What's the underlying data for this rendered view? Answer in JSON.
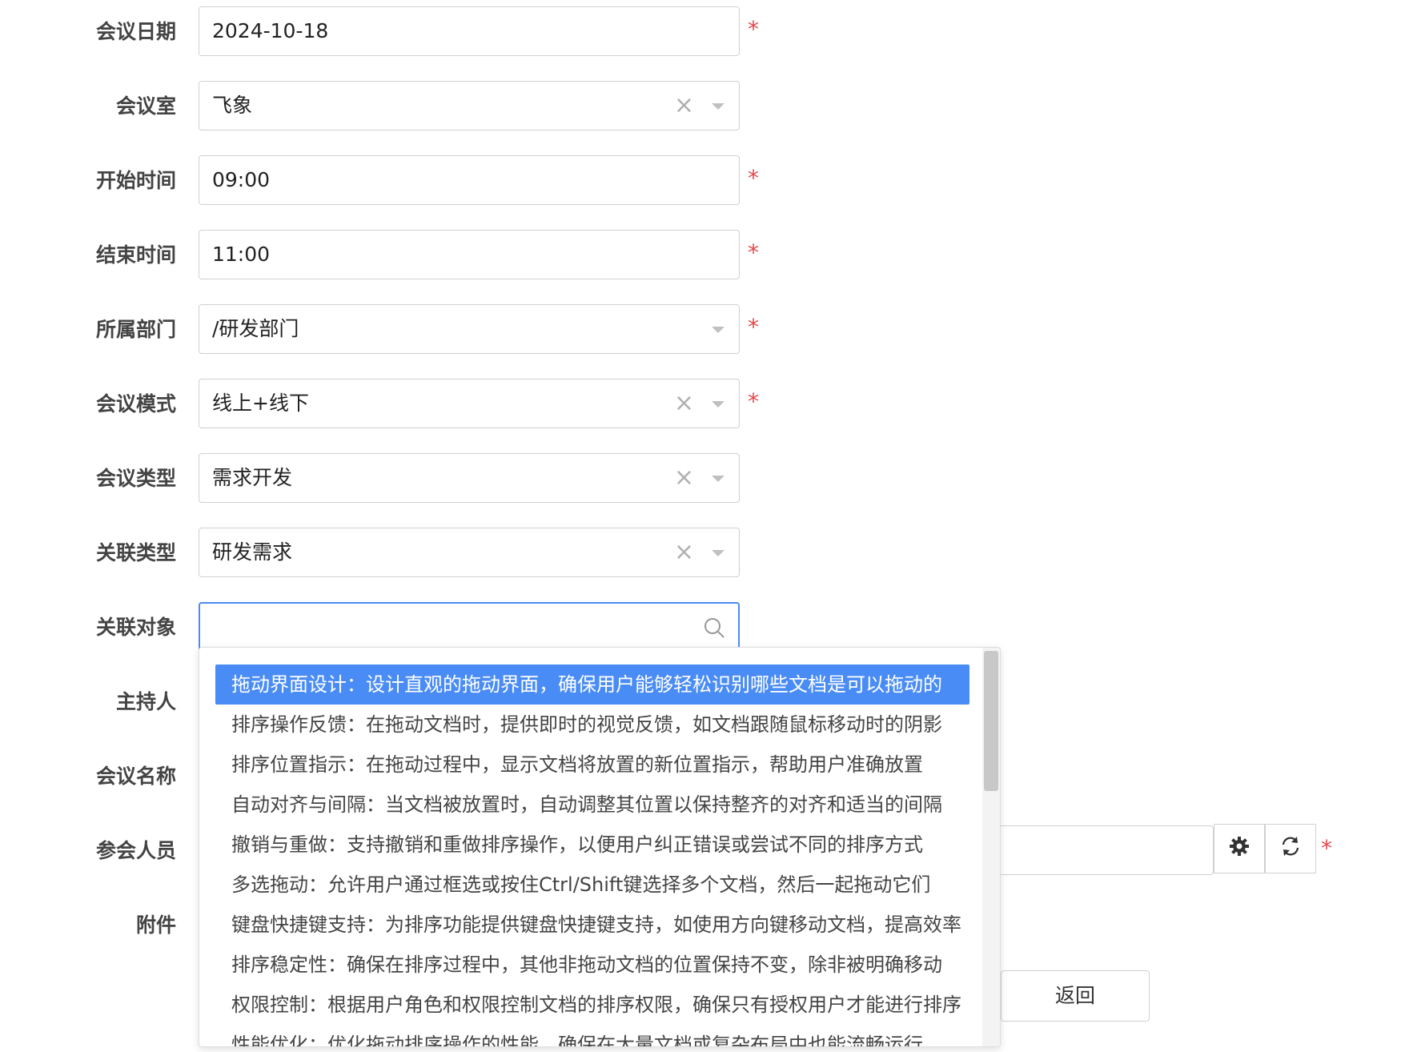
{
  "form": {
    "meeting_date": {
      "label": "会议日期",
      "value": "2024-10-18"
    },
    "meeting_room": {
      "label": "会议室",
      "value": "飞象"
    },
    "start_time": {
      "label": "开始时间",
      "value": "09:00"
    },
    "end_time": {
      "label": "结束时间",
      "value": "11:00"
    },
    "department": {
      "label": "所属部门",
      "value": "/研发部门"
    },
    "meeting_mode": {
      "label": "会议模式",
      "value": "线上+线下"
    },
    "meeting_type": {
      "label": "会议类型",
      "value": "需求开发"
    },
    "related_type": {
      "label": "关联类型",
      "value": "研发需求"
    },
    "related_object": {
      "label": "关联对象",
      "value": ""
    },
    "host": {
      "label": "主持人"
    },
    "meeting_name": {
      "label": "会议名称"
    },
    "participants": {
      "label": "参会人员"
    },
    "attachment": {
      "label": "附件"
    }
  },
  "required_mark": "*",
  "clear_glyph": "×",
  "dropdown": {
    "items": [
      "拖动界面设计：设计直观的拖动界面，确保用户能够轻松识别哪些文档是可以拖动的",
      "排序操作反馈：在拖动文档时，提供即时的视觉反馈，如文档跟随鼠标移动时的阴影",
      "排序位置指示：在拖动过程中，显示文档将放置的新位置指示，帮助用户准确放置",
      "自动对齐与间隔：当文档被放置时，自动调整其位置以保持整齐的对齐和适当的间隔",
      "撤销与重做：支持撤销和重做排序操作，以便用户纠正错误或尝试不同的排序方式",
      "多选拖动：允许用户通过框选或按住Ctrl/Shift键选择多个文档，然后一起拖动它们",
      "键盘快捷键支持：为排序功能提供键盘快捷键支持，如使用方向键移动文档，提高效率",
      "排序稳定性：确保在排序过程中，其他非拖动文档的位置保持不变，除非被明确移动",
      "权限控制：根据用户角色和权限控制文档的排序权限，确保只有授权用户才能进行排序",
      "性能优化：优化拖动排序操作的性能，确保在大量文档或复杂布局中也能流畅运行"
    ]
  },
  "buttons": {
    "back": "返回"
  },
  "icons": {
    "search": "search-icon",
    "settings": "gear-icon",
    "refresh": "refresh-icon"
  },
  "colors": {
    "accent": "#4a8cf5",
    "required": "#e5484d"
  }
}
